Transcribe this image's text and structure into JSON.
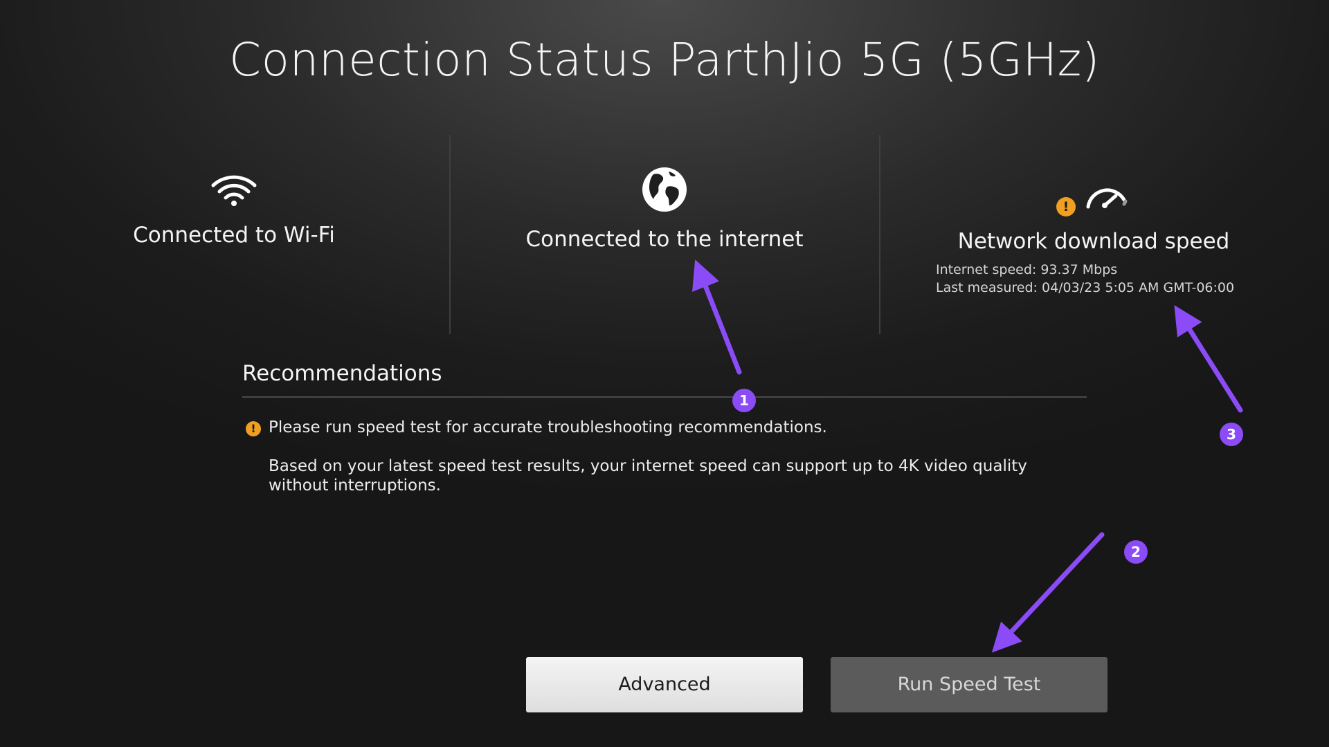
{
  "page": {
    "title": "Connection Status ParthJio 5G (5GHz)"
  },
  "status_panels": {
    "wifi": {
      "icon": "wifi-icon",
      "label": "Connected to Wi-Fi"
    },
    "internet": {
      "icon": "globe-icon",
      "label": "Connected to the internet"
    },
    "speed": {
      "icon": "speedometer-icon",
      "warning_icon": "warning-icon",
      "warning_symbol": "!",
      "label": "Network download speed",
      "internet_speed": "Internet speed: 93.37 Mbps",
      "last_measured": "Last measured: 04/03/23 5:05 AM GMT-06:00"
    }
  },
  "recommendations": {
    "heading": "Recommendations",
    "warning_symbol": "!",
    "items": [
      "Please run speed test for accurate troubleshooting recommendations.",
      "Based on your latest speed test results, your internet speed can support up to 4K video quality",
      "without interruptions."
    ]
  },
  "buttons": {
    "advanced": "Advanced",
    "run_speed_test": "Run Speed Test"
  },
  "annotations": {
    "badges": [
      "1",
      "2",
      "3"
    ],
    "color": "#8b4cf7"
  },
  "colors": {
    "warning": "#f0a020",
    "background": "#1c1c1c",
    "accent": "#8b4cf7"
  }
}
